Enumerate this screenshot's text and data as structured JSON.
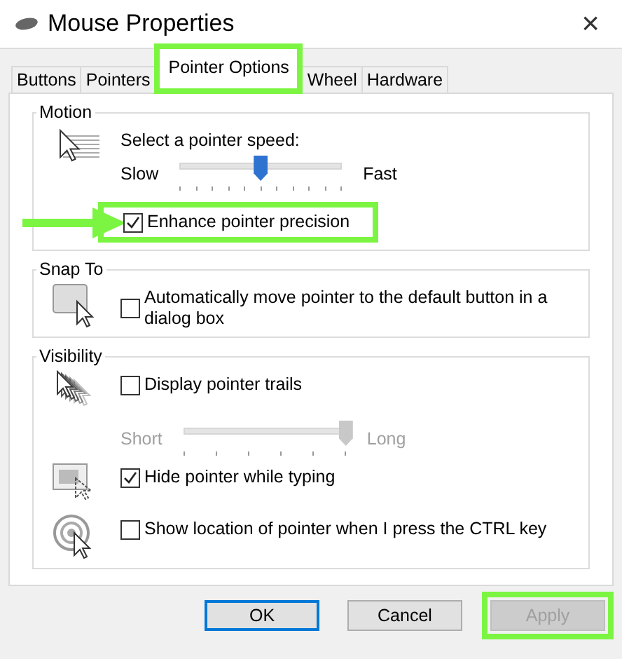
{
  "window": {
    "title": "Mouse Properties",
    "close": "×"
  },
  "tabs": [
    {
      "label": "Buttons",
      "selected": false,
      "highlighted": false
    },
    {
      "label": "Pointers",
      "selected": false,
      "highlighted": false
    },
    {
      "label": "Pointer Options",
      "selected": true,
      "highlighted": true
    },
    {
      "label": "Wheel",
      "selected": false,
      "highlighted": false
    },
    {
      "label": "Hardware",
      "selected": false,
      "highlighted": false
    }
  ],
  "groups": [
    {
      "title": "Motion",
      "rows": [
        {
          "kind": "slider",
          "label": "Select a pointer speed:",
          "min_label": "Slow",
          "max_label": "Fast",
          "level": 0.5,
          "disabled": false
        },
        {
          "kind": "checkbox",
          "label": "Enhance pointer precision",
          "checked": true,
          "highlighted": true
        }
      ]
    },
    {
      "title": "Snap To",
      "rows": [
        {
          "kind": "checkbox",
          "label": "Automatically move pointer to the default button in a dialog box",
          "checked": false,
          "highlighted": false
        }
      ]
    },
    {
      "title": "Visibility",
      "rows": [
        {
          "kind": "checkbox",
          "label": "Display pointer trails",
          "checked": false,
          "highlighted": false
        },
        {
          "kind": "slider",
          "min_label": "Short",
          "max_label": "Long",
          "level": 1,
          "disabled": true
        },
        {
          "kind": "checkbox",
          "label": "Hide pointer while typing",
          "checked": true,
          "highlighted": false
        },
        {
          "kind": "checkbox",
          "label": "Show location of pointer when I press the CTRL key",
          "checked": false,
          "highlighted": false
        }
      ]
    }
  ],
  "buttons": [
    {
      "label": "OK",
      "default": true,
      "disabled": false,
      "highlighted": false
    },
    {
      "label": "Cancel",
      "default": false,
      "disabled": false,
      "highlighted": false
    },
    {
      "label": "Apply",
      "default": false,
      "disabled": true,
      "highlighted": true
    }
  ]
}
